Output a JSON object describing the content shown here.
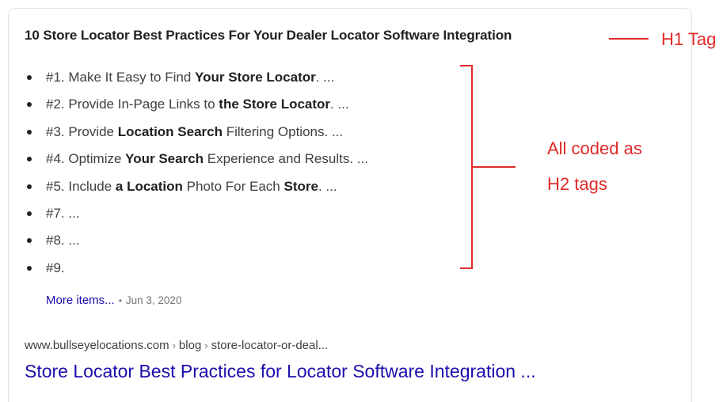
{
  "snippet": {
    "title": "10 Store Locator Best Practices For Your Dealer Locator Software Integration",
    "items": [
      {
        "parts": [
          {
            "t": "#1. Make It Easy to Find ",
            "b": false
          },
          {
            "t": "Your Store Locator",
            "b": true
          },
          {
            "t": ". ...",
            "b": false
          }
        ]
      },
      {
        "parts": [
          {
            "t": "#2. Provide In-Page Links to ",
            "b": false
          },
          {
            "t": "the Store Locator",
            "b": true
          },
          {
            "t": ". ...",
            "b": false
          }
        ]
      },
      {
        "parts": [
          {
            "t": "#3. Provide ",
            "b": false
          },
          {
            "t": "Location Search",
            "b": true
          },
          {
            "t": " Filtering Options. ...",
            "b": false
          }
        ]
      },
      {
        "parts": [
          {
            "t": "#4. Optimize ",
            "b": false
          },
          {
            "t": "Your Search",
            "b": true
          },
          {
            "t": " Experience and Results. ...",
            "b": false
          }
        ]
      },
      {
        "parts": [
          {
            "t": "#5. Include ",
            "b": false
          },
          {
            "t": "a Location",
            "b": true
          },
          {
            "t": " Photo For Each ",
            "b": false
          },
          {
            "t": "Store",
            "b": true
          },
          {
            "t": ". ...",
            "b": false
          }
        ]
      },
      {
        "parts": [
          {
            "t": "#7. ...",
            "b": false
          }
        ]
      },
      {
        "parts": [
          {
            "t": "#8. ...",
            "b": false
          }
        ]
      },
      {
        "parts": [
          {
            "t": "#9.",
            "b": false
          }
        ]
      }
    ],
    "more_items_label": "More items...",
    "separator": "•",
    "date": "Jun 3, 2020"
  },
  "result": {
    "breadcrumb": {
      "domain": "www.bullseyelocations.com",
      "separator": "›",
      "path1": "blog",
      "path2": "store-locator-or-deal..."
    },
    "link_title": "Store Locator Best Practices for Locator Software Integration ..."
  },
  "annotations": {
    "h1_label": "H1 Tag",
    "h2_line1": "All coded as",
    "h2_line2": "H2 tags",
    "color": "#e02a2a"
  },
  "colors": {
    "link": "#1a0dab",
    "text": "#202124",
    "muted": "#70757a"
  }
}
